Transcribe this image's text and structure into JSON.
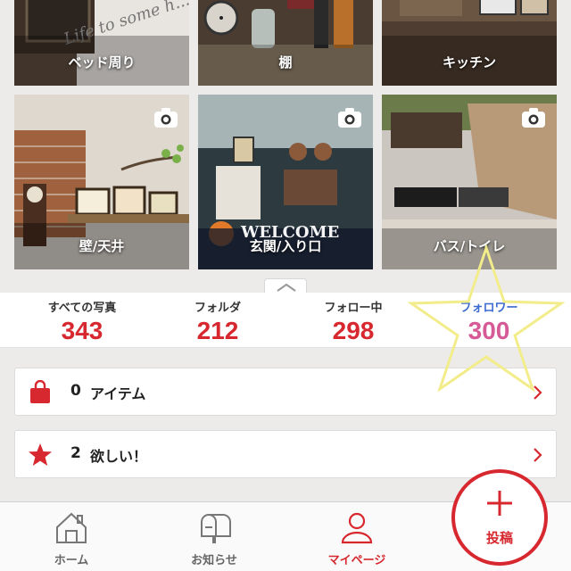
{
  "grid": {
    "tiles": [
      {
        "label": "ベッド周り"
      },
      {
        "label": "棚"
      },
      {
        "label": "キッチン"
      },
      {
        "label": "壁/天井"
      },
      {
        "label": "玄関/入り口"
      },
      {
        "label": "バス/トイレ"
      }
    ],
    "sign_text": "WELCOME",
    "wall_text": "Life to some h..."
  },
  "stats": [
    {
      "name": "すべての写真",
      "value": "343"
    },
    {
      "name": "フォルダ",
      "value": "212"
    },
    {
      "name": "フォロー中",
      "value": "298"
    },
    {
      "name": "フォロワー",
      "value": "300"
    }
  ],
  "rows": {
    "items": {
      "count": "0",
      "label": "アイテム"
    },
    "wants": {
      "count": "2",
      "label": "欲しい！"
    }
  },
  "nav": {
    "home": "ホーム",
    "notices": "お知らせ",
    "mypage": "マイページ",
    "post": "投稿"
  },
  "colors": {
    "accent": "#d7282f",
    "follower_label": "#3a6ad0",
    "follower_value": "#d65a96",
    "star_outline": "#f2ec8a"
  }
}
